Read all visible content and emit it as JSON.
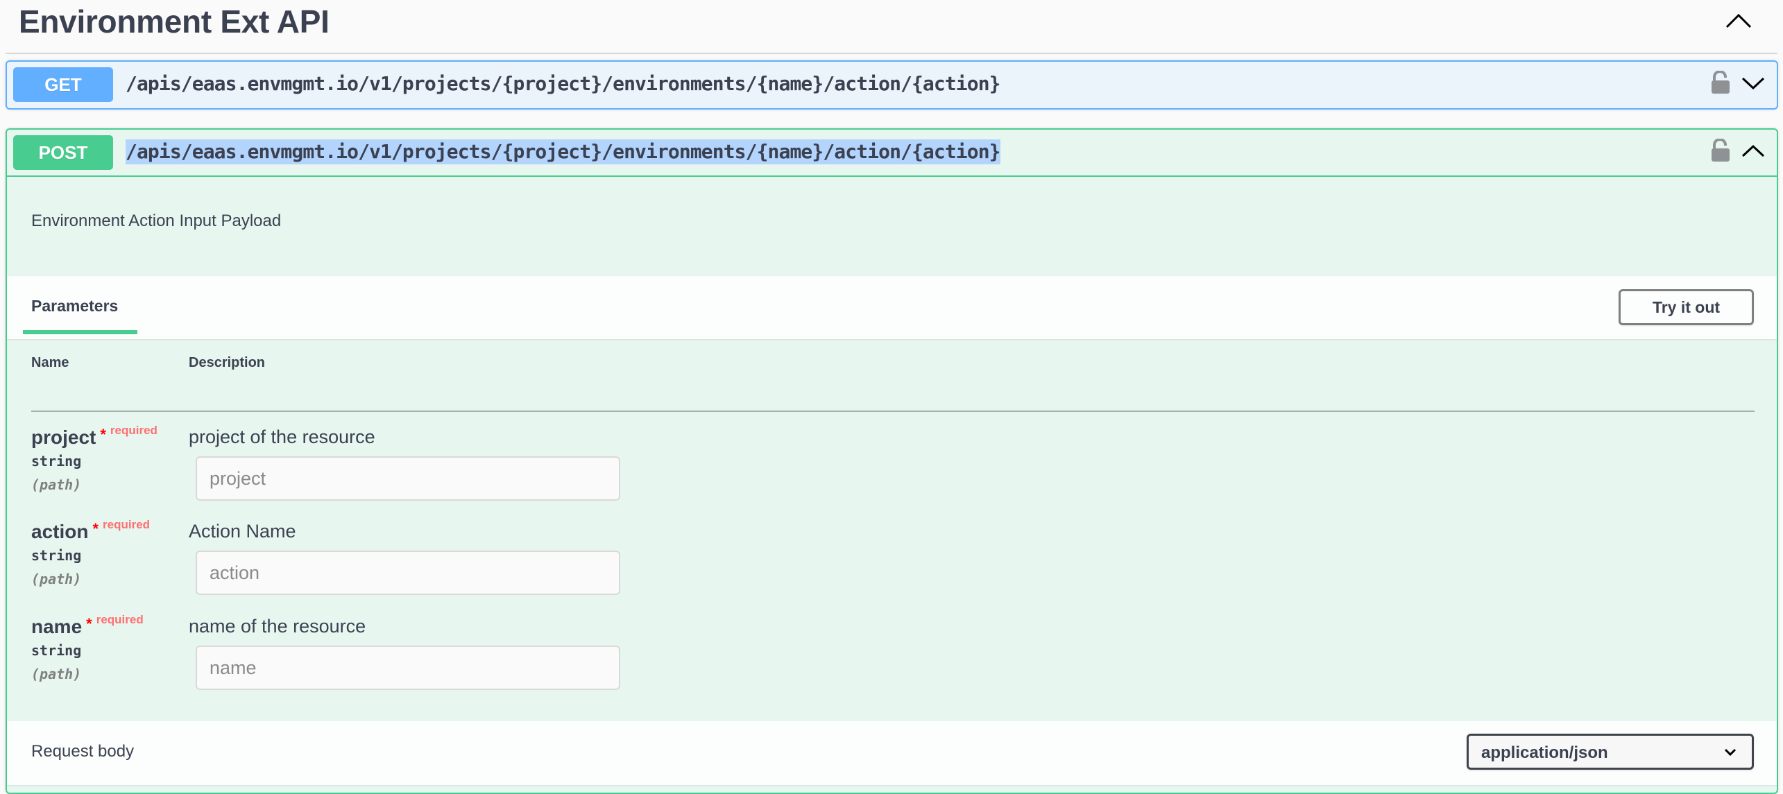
{
  "tag": {
    "title": "Environment Ext API",
    "expanded": true,
    "chevron_icon": "chevron-up-icon"
  },
  "operations": [
    {
      "method": "GET",
      "path": "/apis/eaas.envmgmt.io/v1/projects/{project}/environments/{name}/action/{action}",
      "expanded": false,
      "lock_icon": "unlocked-icon",
      "chevron_icon": "chevron-down-icon",
      "color": "#61affe"
    },
    {
      "method": "POST",
      "path": "/apis/eaas.envmgmt.io/v1/projects/{project}/environments/{name}/action/{action}",
      "expanded": true,
      "path_selected": true,
      "lock_icon": "unlocked-icon",
      "chevron_icon": "chevron-up-icon",
      "color": "#49cc90",
      "description": "Environment Action Input Payload",
      "tabs": [
        {
          "label": "Parameters",
          "active": true
        }
      ],
      "try_it_out_label": "Try it out",
      "parameters_table": {
        "headers": {
          "name": "Name",
          "description": "Description"
        },
        "rows": [
          {
            "name": "project",
            "star": "*",
            "required_label": "required",
            "type": "string",
            "in": "(path)",
            "description": "project of the resource",
            "placeholder": "project",
            "value": ""
          },
          {
            "name": "action",
            "star": "*",
            "required_label": "required",
            "type": "string",
            "in": "(path)",
            "description": "Action Name",
            "placeholder": "action",
            "value": ""
          },
          {
            "name": "name",
            "star": "*",
            "required_label": "required",
            "type": "string",
            "in": "(path)",
            "description": "name of the resource",
            "placeholder": "name",
            "value": ""
          }
        ]
      },
      "request_body": {
        "label": "Request body",
        "content_type": "application/json"
      }
    }
  ]
}
